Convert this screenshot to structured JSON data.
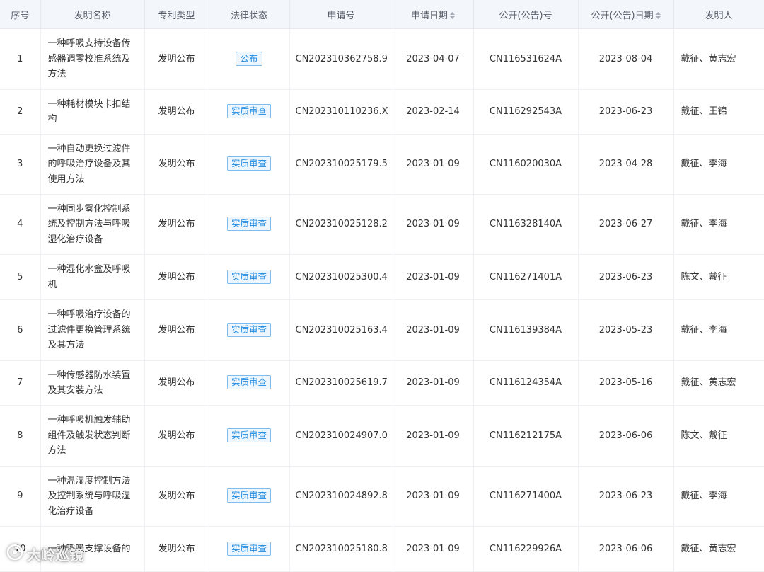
{
  "headers": {
    "index": "序号",
    "name": "发明名称",
    "type": "专利类型",
    "status": "法律状态",
    "app_no": "申请号",
    "app_date": "申请日期",
    "pub_no": "公开(公告)号",
    "pub_date": "公开(公告)日期",
    "inventor": "发明人"
  },
  "rows": [
    {
      "index": "1",
      "name": "一种呼吸支持设备传感器调零校准系统及方法",
      "type": "发明公布",
      "status": "公布",
      "app_no": "CN202310362758.9",
      "app_date": "2023-04-07",
      "pub_no": "CN116531624A",
      "pub_date": "2023-08-04",
      "inventor": "戴征、黄志宏"
    },
    {
      "index": "2",
      "name": "一种耗材模块卡扣结构",
      "type": "发明公布",
      "status": "实质审查",
      "app_no": "CN202310110236.X",
      "app_date": "2023-02-14",
      "pub_no": "CN116292543A",
      "pub_date": "2023-06-23",
      "inventor": "戴征、王锦"
    },
    {
      "index": "3",
      "name": "一种自动更换过滤件的呼吸治疗设备及其使用方法",
      "type": "发明公布",
      "status": "实质审查",
      "app_no": "CN202310025179.5",
      "app_date": "2023-01-09",
      "pub_no": "CN116020030A",
      "pub_date": "2023-04-28",
      "inventor": "戴征、李海"
    },
    {
      "index": "4",
      "name": "一种同步雾化控制系统及控制方法与呼吸湿化治疗设备",
      "type": "发明公布",
      "status": "实质审查",
      "app_no": "CN202310025128.2",
      "app_date": "2023-01-09",
      "pub_no": "CN116328140A",
      "pub_date": "2023-06-27",
      "inventor": "戴征、李海"
    },
    {
      "index": "5",
      "name": "一种湿化水盒及呼吸机",
      "type": "发明公布",
      "status": "实质审查",
      "app_no": "CN202310025300.4",
      "app_date": "2023-01-09",
      "pub_no": "CN116271401A",
      "pub_date": "2023-06-23",
      "inventor": "陈文、戴征"
    },
    {
      "index": "6",
      "name": "一种呼吸治疗设备的过滤件更换管理系统及其方法",
      "type": "发明公布",
      "status": "实质审查",
      "app_no": "CN202310025163.4",
      "app_date": "2023-01-09",
      "pub_no": "CN116139384A",
      "pub_date": "2023-05-23",
      "inventor": "戴征、李海"
    },
    {
      "index": "7",
      "name": "一种传感器防水装置及其安装方法",
      "type": "发明公布",
      "status": "实质审查",
      "app_no": "CN202310025619.7",
      "app_date": "2023-01-09",
      "pub_no": "CN116124354A",
      "pub_date": "2023-05-16",
      "inventor": "戴征、黄志宏"
    },
    {
      "index": "8",
      "name": "一种呼吸机触发辅助组件及触发状态判断方法",
      "type": "发明公布",
      "status": "实质审查",
      "app_no": "CN202310024907.0",
      "app_date": "2023-01-09",
      "pub_no": "CN116212175A",
      "pub_date": "2023-06-06",
      "inventor": "陈文、戴征"
    },
    {
      "index": "9",
      "name": "一种温湿度控制方法及控制系统与呼吸湿化治疗设备",
      "type": "发明公布",
      "status": "实质审查",
      "app_no": "CN202310024892.8",
      "app_date": "2023-01-09",
      "pub_no": "CN116271400A",
      "pub_date": "2023-06-23",
      "inventor": "戴征、李海"
    },
    {
      "index": "10",
      "name": "一种呼吸支撑设备的",
      "type": "发明公布",
      "status": "实质审查",
      "app_no": "CN202310025180.8",
      "app_date": "2023-01-09",
      "pub_no": "CN116229926A",
      "pub_date": "2023-06-06",
      "inventor": "戴征、黄志宏"
    }
  ],
  "watermark": {
    "text": "大岭巡镜",
    "icon": "sun-swirl-icon"
  },
  "colors": {
    "header_bg": "#f3f6fa",
    "tag_blue": "#1f8ae0",
    "tag_bg": "#eef7ff",
    "border": "#e6e9ee"
  },
  "icons": {
    "sort": "sort-arrows-icon"
  }
}
